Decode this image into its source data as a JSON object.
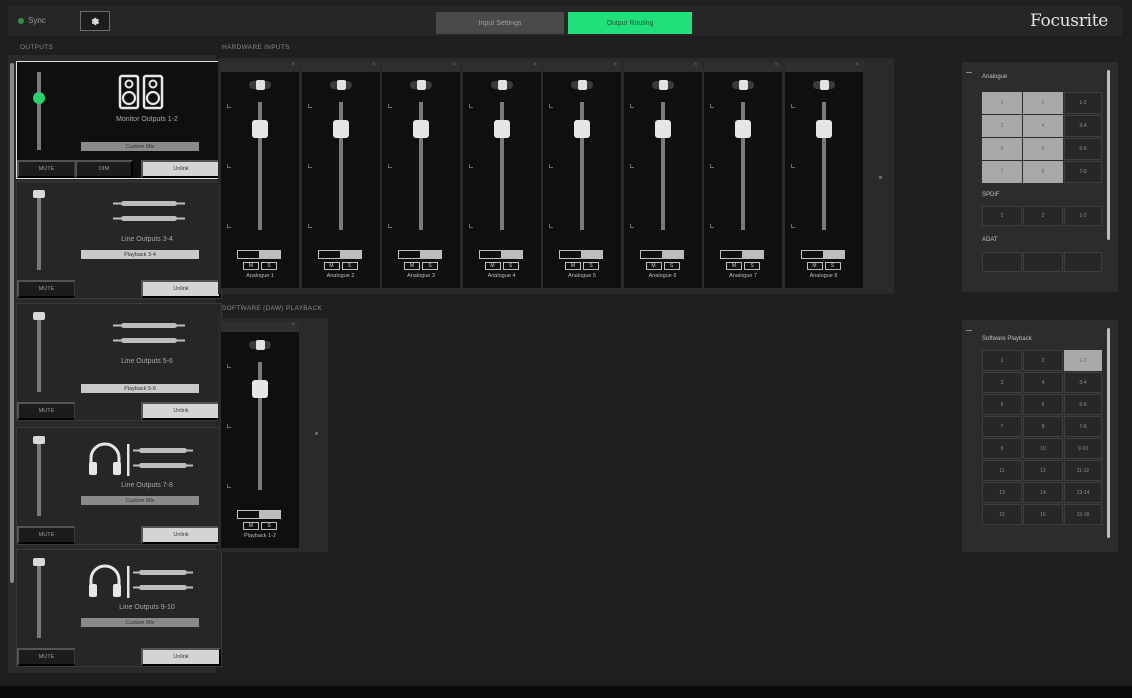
{
  "header": {
    "sync_label": "Sync",
    "tabs": [
      {
        "label": "Input Settings",
        "active": false
      },
      {
        "label": "Output Routing",
        "active": true
      }
    ],
    "brand": "Focusrite"
  },
  "colors": {
    "accent": "#1fe07a",
    "background": "#1f1f1f",
    "panel": "#2a2a2a"
  },
  "sections": {
    "outputs": "OUTPUTS",
    "hardware_inputs": "HARDWARE INPUTS",
    "software_playback": "SOFTWARE (DAW) PLAYBACK"
  },
  "outputs": [
    {
      "name": "Monitor Outputs 1-2",
      "source": "Custom Mix",
      "icon": "speakers-icon",
      "mute": "MUTE",
      "dim": "DIM",
      "link": "Unlink",
      "selected": true
    },
    {
      "name": "Line Outputs 3-4",
      "source": "Playback 3-4",
      "icon": "line-cables-icon",
      "mute": "MUTE",
      "link": "Unlink",
      "selected": false
    },
    {
      "name": "Line Outputs 5-6",
      "source": "Playback 5-6",
      "icon": "line-cables-icon",
      "mute": "MUTE",
      "link": "Unlink",
      "selected": false
    },
    {
      "name": "Line Outputs 7-8",
      "source": "Custom Mix",
      "icon": "headphones-icon",
      "mute": "MUTE",
      "link": "Unlink",
      "selected": false
    },
    {
      "name": "Line Outputs 9-10",
      "source": "Custom Mix",
      "icon": "headphones-icon",
      "mute": "MUTE",
      "link": "Unlink",
      "selected": false
    }
  ],
  "hardware_inputs": [
    {
      "name": "Analogue 1",
      "m": "M",
      "s": "S"
    },
    {
      "name": "Analogue 2",
      "m": "M",
      "s": "S"
    },
    {
      "name": "Analogue 3",
      "m": "M",
      "s": "S"
    },
    {
      "name": "Analogue 4",
      "m": "M",
      "s": "S"
    },
    {
      "name": "Analogue 5",
      "m": "M",
      "s": "S"
    },
    {
      "name": "Analogue 6",
      "m": "M",
      "s": "S"
    },
    {
      "name": "Analogue 7",
      "m": "M",
      "s": "S"
    },
    {
      "name": "Analogue 8",
      "m": "M",
      "s": "S"
    }
  ],
  "software_playback": [
    {
      "name": "Playback 1-2",
      "m": "M",
      "s": "S"
    }
  ],
  "matrix_inputs": {
    "groups": [
      {
        "title": "Analogue",
        "cells": [
          "1",
          "2",
          "1-2",
          "3",
          "4",
          "3-4",
          "5",
          "6",
          "5-6",
          "7",
          "8",
          "7-8"
        ],
        "selected": [
          0,
          1,
          3,
          4,
          6,
          7,
          9,
          10
        ]
      },
      {
        "title": "SPDIF",
        "cells": [
          "1",
          "2",
          "1-2"
        ],
        "selected": []
      },
      {
        "title": "ADAT",
        "cells": [
          "",
          "",
          ""
        ],
        "selected": []
      }
    ]
  },
  "matrix_playback": {
    "title": "Software Playback",
    "cells": [
      "1",
      "2",
      "1-2",
      "3",
      "4",
      "3-4",
      "5",
      "6",
      "5-6",
      "7",
      "8",
      "7-8",
      "9",
      "10",
      "9-10",
      "11",
      "12",
      "11-12",
      "13",
      "14",
      "13-14",
      "15",
      "16",
      "15-16"
    ],
    "selected": [
      2
    ]
  }
}
